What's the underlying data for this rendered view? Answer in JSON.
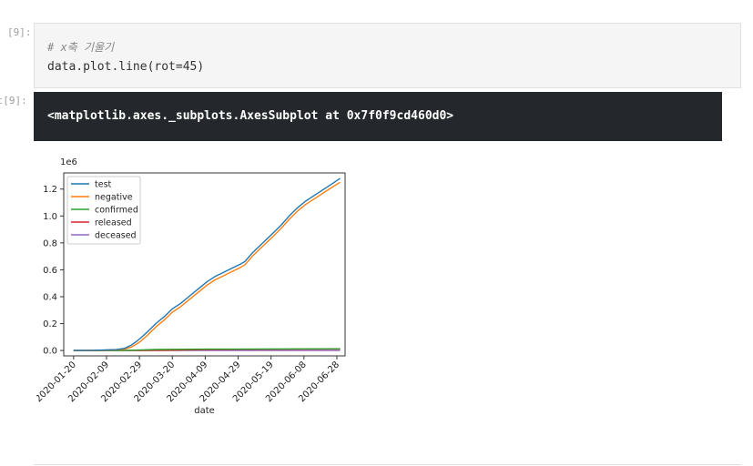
{
  "cells": {
    "input": {
      "prompt": "[9]:",
      "comment": "# x축 기울기",
      "code": "data.plot.line(rot=45)"
    },
    "output": {
      "prompt": "ut[9]:",
      "text": "<matplotlib.axes._subplots.AxesSubplot at 0x7f0f9cd460d0>"
    }
  },
  "chart_data": {
    "type": "line",
    "x_ticks": [
      "2020-01-20",
      "2020-02-09",
      "2020-02-29",
      "2020-03-20",
      "2020-04-09",
      "2020-04-29",
      "2020-05-19",
      "2020-06-08",
      "2020-06-28"
    ],
    "xlabel": "date",
    "ylabel": "",
    "y_ticks": [
      "0.0",
      "0.2",
      "0.4",
      "0.6",
      "0.8",
      "1.0",
      "1.2"
    ],
    "y_offset_label": "1e6",
    "ylim": [
      -0.04,
      1.32
    ],
    "x_range_days": [
      -6,
      165
    ],
    "legend_position": "upper left",
    "series": [
      {
        "name": "test",
        "color": "#1f77b4",
        "x": [
          "2020-01-20",
          "2020-02-01",
          "2020-02-15",
          "2020-02-20",
          "2020-02-24",
          "2020-02-27",
          "2020-03-01",
          "2020-03-05",
          "2020-03-10",
          "2020-03-15",
          "2020-03-20",
          "2020-03-25",
          "2020-03-31",
          "2020-04-05",
          "2020-04-10",
          "2020-04-15",
          "2020-04-20",
          "2020-04-25",
          "2020-04-30",
          "2020-05-03",
          "2020-05-08",
          "2020-05-14",
          "2020-05-20",
          "2020-05-25",
          "2020-05-30",
          "2020-06-04",
          "2020-06-09",
          "2020-06-14",
          "2020-06-19",
          "2020-06-24",
          "2020-06-30"
        ],
        "y": [
          0.0,
          0.001,
          0.007,
          0.016,
          0.04,
          0.065,
          0.095,
          0.14,
          0.2,
          0.25,
          0.31,
          0.35,
          0.41,
          0.46,
          0.51,
          0.55,
          0.58,
          0.61,
          0.64,
          0.66,
          0.73,
          0.8,
          0.87,
          0.93,
          1.0,
          1.06,
          1.11,
          1.15,
          1.19,
          1.23,
          1.28
        ]
      },
      {
        "name": "negative",
        "color": "#ff7f0e",
        "x": [
          "2020-01-20",
          "2020-02-01",
          "2020-02-15",
          "2020-02-20",
          "2020-02-24",
          "2020-02-27",
          "2020-03-01",
          "2020-03-05",
          "2020-03-10",
          "2020-03-15",
          "2020-03-20",
          "2020-03-25",
          "2020-03-31",
          "2020-04-05",
          "2020-04-10",
          "2020-04-15",
          "2020-04-20",
          "2020-04-25",
          "2020-04-30",
          "2020-05-03",
          "2020-05-08",
          "2020-05-14",
          "2020-05-20",
          "2020-05-25",
          "2020-05-30",
          "2020-06-04",
          "2020-06-09",
          "2020-06-14",
          "2020-06-19",
          "2020-06-24",
          "2020-06-30"
        ],
        "y": [
          0.0,
          0.001,
          0.005,
          0.011,
          0.025,
          0.045,
          0.07,
          0.115,
          0.175,
          0.225,
          0.285,
          0.325,
          0.385,
          0.435,
          0.485,
          0.525,
          0.555,
          0.585,
          0.615,
          0.635,
          0.705,
          0.775,
          0.845,
          0.905,
          0.975,
          1.035,
          1.085,
          1.125,
          1.165,
          1.205,
          1.25
        ]
      },
      {
        "name": "confirmed",
        "color": "#2ca02c",
        "x": [
          "2020-01-20",
          "2020-02-20",
          "2020-03-10",
          "2020-04-10",
          "2020-06-30"
        ],
        "y": [
          0.0,
          0.0001,
          0.0075,
          0.0104,
          0.0129
        ]
      },
      {
        "name": "released",
        "color": "#d62728",
        "x": [
          "2020-01-20",
          "2020-03-01",
          "2020-03-20",
          "2020-04-10",
          "2020-05-01",
          "2020-06-30"
        ],
        "y": [
          0.0,
          0.0,
          0.002,
          0.007,
          0.009,
          0.0115
        ]
      },
      {
        "name": "deceased",
        "color": "#9467bd",
        "x": [
          "2020-01-20",
          "2020-03-01",
          "2020-04-10",
          "2020-06-30"
        ],
        "y": [
          0.0,
          0.0,
          0.0002,
          0.0003
        ]
      }
    ]
  }
}
